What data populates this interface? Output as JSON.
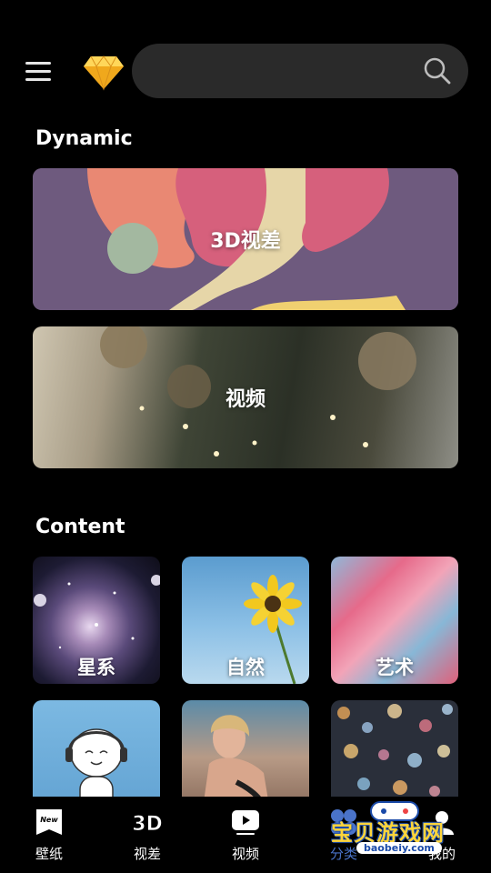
{
  "header": {
    "search_placeholder": "",
    "icons": {
      "menu": "menu-icon",
      "premium": "diamond-icon",
      "search": "search-icon"
    }
  },
  "sections": {
    "dynamic_title": "Dynamic",
    "content_title": "Content"
  },
  "dynamic_banners": [
    {
      "label": "3D视差"
    },
    {
      "label": "视频"
    }
  ],
  "content_tiles": [
    {
      "label": "星系"
    },
    {
      "label": "自然"
    },
    {
      "label": "艺术"
    },
    {
      "label": ""
    },
    {
      "label": ""
    },
    {
      "label": ""
    }
  ],
  "bottom_nav": {
    "items": [
      {
        "label": "壁纸",
        "icon": "new-badge-icon"
      },
      {
        "label": "视差",
        "icon": "3d-icon"
      },
      {
        "label": "视频",
        "icon": "play-icon"
      },
      {
        "label": "分类",
        "icon": "category-icon",
        "active": true
      },
      {
        "label": "我的",
        "icon": "profile-icon"
      }
    ]
  },
  "watermark": {
    "text": "宝贝游戏网",
    "url": "baobeiy.com"
  },
  "colors": {
    "background": "#000000",
    "search_bg": "#2a2a2a",
    "accent": "#4a73c9",
    "diamond": "#f5b82a"
  }
}
